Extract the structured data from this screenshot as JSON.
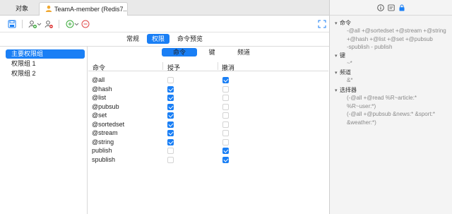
{
  "tabs": [
    {
      "label": "对象"
    },
    {
      "label": "TeamA-member (Redis7..."
    }
  ],
  "main_segments": [
    "常规",
    "权限",
    "命令预览"
  ],
  "main_active": 1,
  "groups": [
    "主要权限组",
    "权限组 1",
    "权限组 2"
  ],
  "groups_active": 0,
  "sub_segments": [
    "命令",
    "键",
    "频道"
  ],
  "sub_active": 0,
  "table": {
    "headers": [
      "命令",
      "授予",
      "撤消"
    ],
    "rows": [
      {
        "name": "@all",
        "grant": false,
        "revoke": true
      },
      {
        "name": "@hash",
        "grant": true,
        "revoke": false
      },
      {
        "name": "@list",
        "grant": true,
        "revoke": false
      },
      {
        "name": "@pubsub",
        "grant": true,
        "revoke": false
      },
      {
        "name": "@set",
        "grant": true,
        "revoke": false
      },
      {
        "name": "@sortedset",
        "grant": true,
        "revoke": false
      },
      {
        "name": "@stream",
        "grant": true,
        "revoke": false
      },
      {
        "name": "@string",
        "grant": true,
        "revoke": false
      },
      {
        "name": "publish",
        "grant": false,
        "revoke": true
      },
      {
        "name": "spublish",
        "grant": false,
        "revoke": true
      }
    ]
  },
  "inspector": {
    "sections": [
      {
        "title": "命令",
        "lines": [
          "-@all +@sortedset +@stream +@string",
          "+@hash +@list +@set +@pubsub",
          "-spublish - publish"
        ]
      },
      {
        "title": "键",
        "lines": [
          "~*"
        ]
      },
      {
        "title": "频道",
        "lines": [
          "&*"
        ]
      },
      {
        "title": "选择器",
        "lines": [
          "(-@all +@read %R~article:* %R~user:*)",
          "(-@all +@pubsub &news:* &sport:*",
          "&weather:*)"
        ]
      }
    ]
  },
  "colors": {
    "accent": "#1a7ff5",
    "add_green": "#3cab3c",
    "remove_red": "#e04848"
  }
}
